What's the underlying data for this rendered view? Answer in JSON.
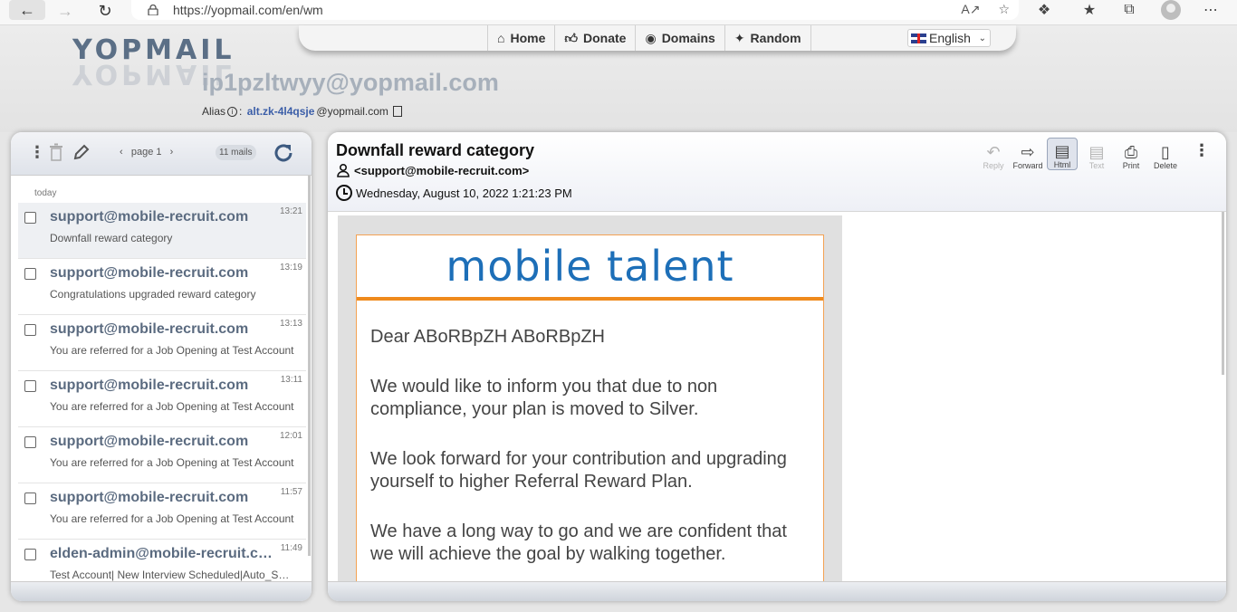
{
  "browser": {
    "url": "https://yopmail.com/en/wm"
  },
  "header": {
    "logo": "YOPMAIL",
    "nav": [
      {
        "label": "Home",
        "icon": "home-icon"
      },
      {
        "label": "Donate",
        "icon": "thumbs-up-icon"
      },
      {
        "label": "Domains",
        "icon": "globe-icon"
      },
      {
        "label": "Random",
        "icon": "magic-wand-icon"
      }
    ],
    "language": "English",
    "email": "ip1pzltwyy@yopmail.com",
    "alias_label": "Alias",
    "alias_name": "alt.zk-4l4qsje",
    "alias_domain": "@yopmail.com"
  },
  "inbox": {
    "page": "page 1",
    "count": "11 mails",
    "day": "today",
    "mails": [
      {
        "from": "support@mobile-recruit.com",
        "time": "13:21",
        "subject": "Downfall reward category"
      },
      {
        "from": "support@mobile-recruit.com",
        "time": "13:19",
        "subject": "Congratulations upgraded reward category"
      },
      {
        "from": "support@mobile-recruit.com",
        "time": "13:13",
        "subject": "You are referred for a Job Opening at Test Account"
      },
      {
        "from": "support@mobile-recruit.com",
        "time": "13:11",
        "subject": "You are referred for a Job Opening at Test Account"
      },
      {
        "from": "support@mobile-recruit.com",
        "time": "12:01",
        "subject": "You are referred for a Job Opening at Test Account"
      },
      {
        "from": "support@mobile-recruit.com",
        "time": "11:57",
        "subject": "You are referred for a Job Opening at Test Account"
      },
      {
        "from": "elden-admin@mobile-recruit.c…",
        "time": "11:49",
        "subject": "Test Account| New Interview Scheduled|Auto_S…"
      }
    ]
  },
  "message": {
    "subject": "Downfall reward category",
    "from": "<support@mobile-recruit.com>",
    "date": "Wednesday, August 10, 2022 1:21:23 PM",
    "actions": {
      "reply": "Reply",
      "forward": "Forward",
      "html": "Html",
      "text": "Text",
      "print": "Print",
      "delete": "Delete"
    },
    "brand": "mobile talent",
    "greeting": "Dear ABoRBpZH ABoRBpZH",
    "para1": "We would like to inform you that due to non compliance, your plan is moved to Silver.",
    "para2": "We look forward for your contribution and upgrading yourself to higher Referral Reward Plan.",
    "para3": "We have a long way to go and we are confident that we will achieve the goal by walking together."
  },
  "colors": {
    "brand_blue": "#1d6fb8",
    "accent_orange": "#ef8a1c",
    "sender_gray": "#5b6b80"
  }
}
